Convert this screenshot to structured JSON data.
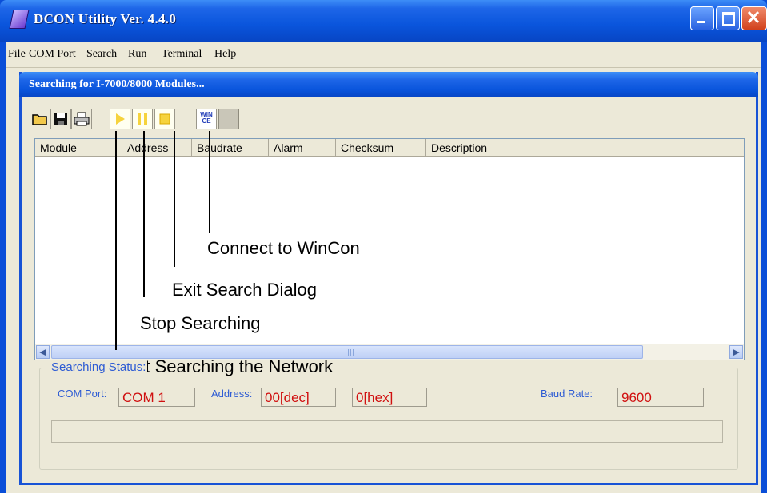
{
  "window": {
    "title": "DCON Utility Ver.  4.4.0"
  },
  "menu": [
    "File",
    "COM Port",
    "Search",
    "Run",
    "Terminal",
    "Help"
  ],
  "dialog": {
    "title": "Searching for I-7000/8000 Modules...",
    "toolbar": {
      "wince_label": "WIN CE"
    },
    "columns": [
      "Module",
      "Address",
      "Baudrate",
      "Alarm",
      "Checksum",
      "Description"
    ],
    "annotations": {
      "connect": "Connect to WinCon",
      "exit": "Exit Search Dialog",
      "stop": "Stop Searching",
      "start": "Start Searching the Network"
    },
    "status": {
      "legend": "Searching Status:",
      "com_port_label": "COM Port:",
      "com_port_value": "COM 1",
      "address_label": "Address:",
      "address_dec": "00[dec]",
      "address_hex": "0[hex]",
      "baud_label": "Baud Rate:",
      "baud_value": "9600"
    }
  }
}
